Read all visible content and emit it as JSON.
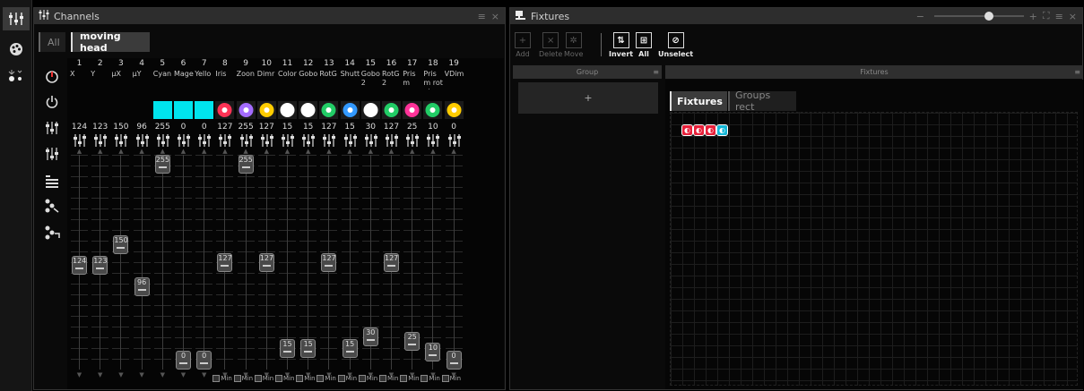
{
  "left_toolbar": {
    "items": [
      {
        "icon": "channels-icon",
        "active": true
      },
      {
        "icon": "palette-icon",
        "active": false
      },
      {
        "icon": "lights-icon",
        "active": false
      }
    ]
  },
  "channels": {
    "title": "Channels",
    "tabs": [
      {
        "label": "All"
      },
      {
        "label": "moving head"
      }
    ],
    "side_tools": [
      "dimmer-knob-icon",
      "power-icon",
      "faders-icon",
      "faders-split-icon",
      "list-grid-icon",
      "cue-link-icon",
      "cue-unlink-icon"
    ],
    "columns": [
      {
        "num": "1",
        "name": "X",
        "value": "124",
        "level": 124,
        "swatch": null,
        "min": false
      },
      {
        "num": "2",
        "name": "Y",
        "value": "123",
        "level": 123,
        "swatch": null,
        "min": false
      },
      {
        "num": "3",
        "name": "µX",
        "value": "150",
        "level": 150,
        "swatch": null,
        "min": false
      },
      {
        "num": "4",
        "name": "µY",
        "value": "96",
        "level": 96,
        "swatch": null,
        "min": false
      },
      {
        "num": "5",
        "name": "Cyan",
        "value": "255",
        "level": 255,
        "swatch": "#00e5ee",
        "min": false
      },
      {
        "num": "6",
        "name": "Mage",
        "value": "0",
        "level": 0,
        "swatch": "#00e5ee",
        "min": false
      },
      {
        "num": "7",
        "name": "Yello",
        "value": "0",
        "level": 0,
        "swatch": "#00e5ee",
        "min": false
      },
      {
        "num": "8",
        "name": "Iris",
        "value": "127",
        "level": 127,
        "swatch": "#ff3355",
        "min": true
      },
      {
        "num": "9",
        "name": "Zoon",
        "value": "255",
        "level": 255,
        "swatch": "#a46cff",
        "min": true
      },
      {
        "num": "10",
        "name": "Dimr",
        "value": "127",
        "level": 127,
        "swatch": "#ffcc00",
        "min": true
      },
      {
        "num": "11",
        "name": "Color",
        "value": "15",
        "level": 15,
        "swatch": "#ffffff",
        "min": true
      },
      {
        "num": "12",
        "name": "Gobo",
        "value": "15",
        "level": 15,
        "swatch": "#ffffff",
        "min": true
      },
      {
        "num": "13",
        "name": "RotG",
        "value": "127",
        "level": 127,
        "swatch": "#22cc66",
        "min": true
      },
      {
        "num": "14",
        "name": "Shutt",
        "value": "15",
        "level": 15,
        "swatch": "#3399ff",
        "min": true
      },
      {
        "num": "15",
        "name": "Gobo 2",
        "value": "30",
        "level": 30,
        "swatch": "#ffffff",
        "min": true
      },
      {
        "num": "16",
        "name": "RotG 2",
        "value": "127",
        "level": 127,
        "swatch": "#22cc66",
        "min": true
      },
      {
        "num": "17",
        "name": "Prism",
        "value": "25",
        "level": 25,
        "swatch": "#ff3399",
        "min": true
      },
      {
        "num": "18",
        "name": "Prism rotat",
        "value": "10",
        "level": 10,
        "swatch": "#22cc66",
        "min": true
      },
      {
        "num": "19",
        "name": "VDim",
        "value": "0",
        "level": 0,
        "swatch": "#ffcc00",
        "min": true
      }
    ],
    "min_label": "Min"
  },
  "fixtures_panel": {
    "title": "Fixtures",
    "tools": [
      {
        "label": "Add",
        "icon": "plus-icon",
        "enabled": false
      },
      {
        "label": "Delete",
        "icon": "close-icon",
        "enabled": false
      },
      {
        "label": "Move",
        "icon": "gear-icon",
        "enabled": false
      },
      {
        "label": "Invert",
        "icon": "invert-icon",
        "enabled": true
      },
      {
        "label": "All",
        "icon": "select-all-icon",
        "enabled": true
      },
      {
        "label": "Unselect",
        "icon": "unselect-icon",
        "enabled": true
      }
    ],
    "group_header": "Group",
    "group_add": "+",
    "fixtures_header": "Fixtures",
    "view_tabs": [
      {
        "label": "Fixtures",
        "active": true
      },
      {
        "label": "Groups rect",
        "active": false
      }
    ],
    "fixtures": [
      {
        "color": "#e8203a",
        "selected": true
      },
      {
        "color": "#e8203a",
        "selected": true
      },
      {
        "color": "#e8203a",
        "selected": true
      },
      {
        "color": "#14b8d8",
        "selected": true
      }
    ],
    "zoom_level": 0.62
  },
  "colors": {
    "accent": "#00e5ee",
    "titlebar": "#2d2d2d"
  }
}
